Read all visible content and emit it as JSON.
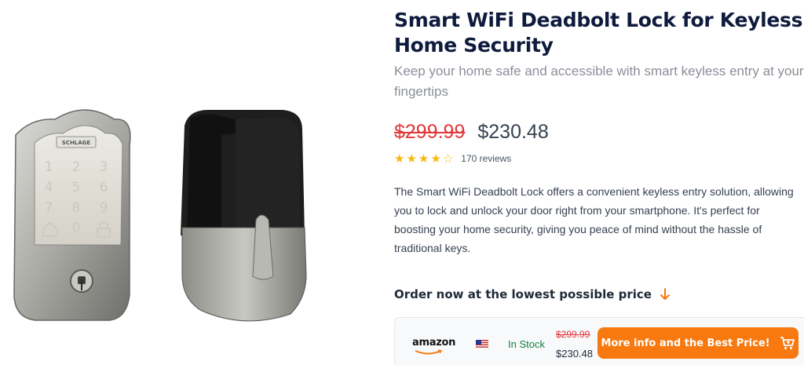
{
  "product": {
    "title": "Smart WiFi Deadbolt Lock for Keyless Home Security",
    "subtitle": "Keep your home safe and accessible with smart keyless entry at your fingertips",
    "old_price": "$299.99",
    "new_price": "$230.48",
    "rating": 4,
    "rating_max": 5,
    "reviews": "170 reviews",
    "description": "The Smart WiFi Deadbolt Lock offers a convenient keyless entry solution, allowing you to lock and unlock your door right from your smartphone. It's perfect for boosting your home security, giving you peace of mind without the hassle of traditional keys.",
    "image": {
      "brand_badge": "SCHLAGE",
      "keypad": [
        "1",
        "2",
        "3",
        "4",
        "5",
        "6",
        "7",
        "8",
        "9",
        "0"
      ]
    }
  },
  "order": {
    "heading": "Order now at the lowest possible price"
  },
  "offer": {
    "store": "amazon",
    "flag_icon": "us-flag-icon",
    "stock": "In Stock",
    "old_price": "$299.99",
    "new_price": "$230.48",
    "cta_label": "More info and the Best Price!",
    "cta_icon": "cart-icon"
  },
  "colors": {
    "accent": "#f7790f",
    "old_price": "#e03a3a",
    "in_stock": "#15803d",
    "star": "#f5b80b",
    "title": "#0f1b3d"
  }
}
